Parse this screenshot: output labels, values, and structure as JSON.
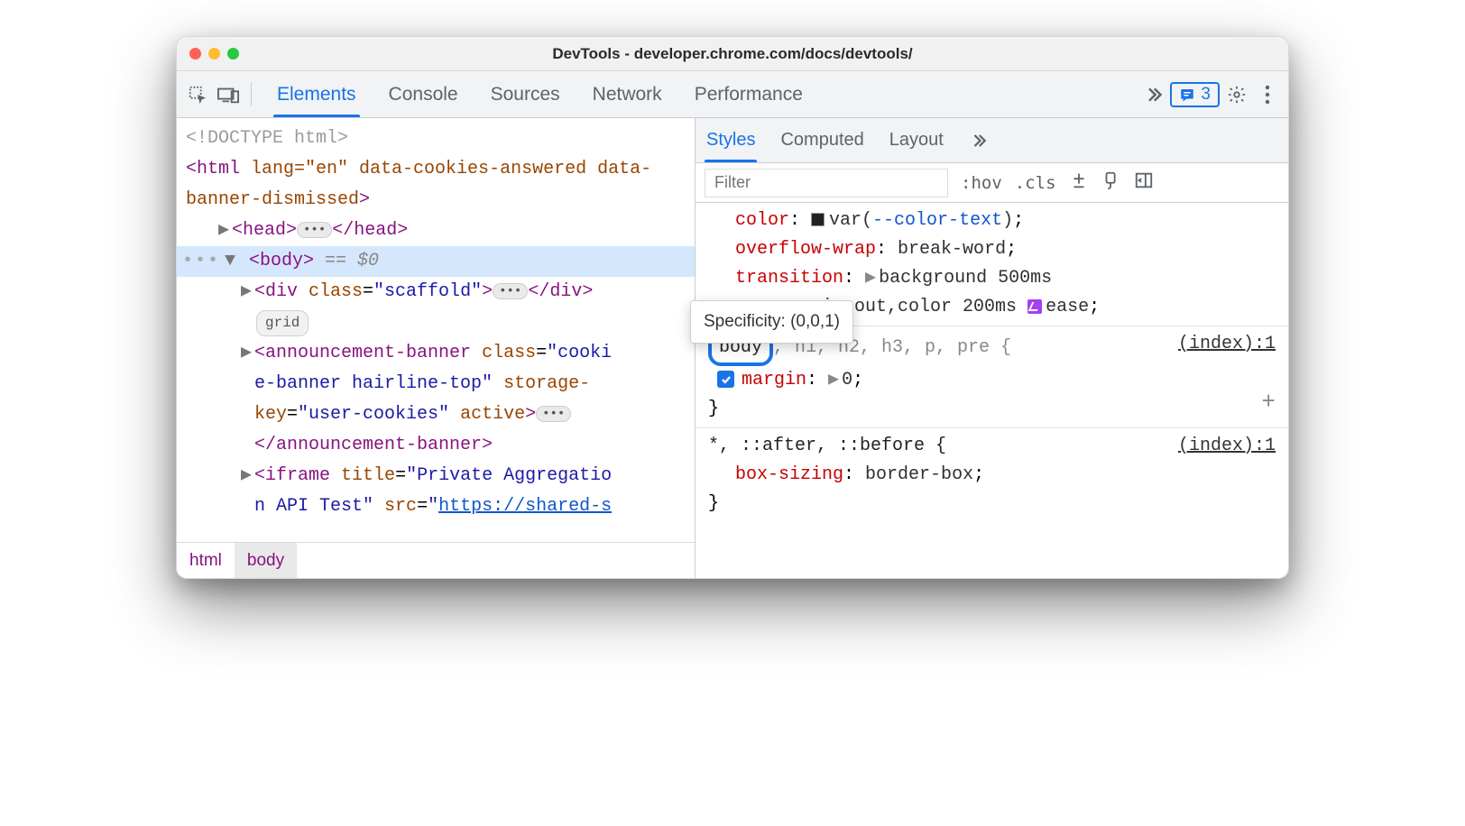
{
  "window": {
    "title": "DevTools - developer.chrome.com/docs/devtools/"
  },
  "main_tabs": [
    "Elements",
    "Console",
    "Sources",
    "Network",
    "Performance"
  ],
  "main_tabs_active": 0,
  "issues_count": "3",
  "dom": {
    "doctype": "<!DOCTYPE html>",
    "html_open": {
      "tag": "html",
      "attrs": " lang=\"en\" data-cookies-answered data-banner-dismissed"
    },
    "head": {
      "open": "<head>",
      "close": "</head>"
    },
    "body_label": "<body>",
    "body_ghost": " == $0",
    "div_scaffold": {
      "open_tag": "div",
      "attr_name": "class",
      "attr_val": "\"scaffold\"",
      "close": "</div>"
    },
    "grid_pill": "grid",
    "banner_line1_tag": "announcement-banner",
    "banner_line1_attr_name": "class",
    "banner_line1_attr_val": "\"cooki",
    "banner_line2_val": "e-banner hairline-top\"",
    "banner_line2_attr2": "storage-",
    "banner_line3_attr": "key",
    "banner_line3_val": "\"user-cookies\"",
    "banner_line3_flag": "active",
    "banner_close": "</announcement-banner>",
    "iframe_tag": "iframe",
    "iframe_title_attr": "title",
    "iframe_title_val": "\"Private Aggregatio",
    "iframe_line2_val_cont": "n API Test\"",
    "iframe_src_attr": "src",
    "iframe_src_val": "https://shared-s"
  },
  "breadcrumbs": [
    "html",
    "body"
  ],
  "sub_tabs": [
    "Styles",
    "Computed",
    "Layout"
  ],
  "sub_tabs_active": 0,
  "filter": {
    "placeholder": "Filter",
    "hov": ":hov",
    "cls": ".cls"
  },
  "tooltip": "Specificity: (0,0,1)",
  "rule0": {
    "color_prop": "color",
    "color_var": "--color-text",
    "overflow_prop": "overflow-wrap",
    "overflow_val": "break-word",
    "transition_prop": "transition",
    "transition_part1": "background 500ms",
    "transition_part2a": "-in-out,color 200ms ",
    "transition_ease": "ease"
  },
  "rule1": {
    "selector_hit": "body",
    "selector_rest": ", h1, h2, h3, p, pre {",
    "source": "(index):1",
    "margin_prop": "margin",
    "margin_val": "0",
    "close": "}"
  },
  "rule2": {
    "selector": "*, ::after, ::before {",
    "source": "(index):1",
    "box_prop": "box-sizing",
    "box_val": "border-box",
    "close": "}"
  }
}
